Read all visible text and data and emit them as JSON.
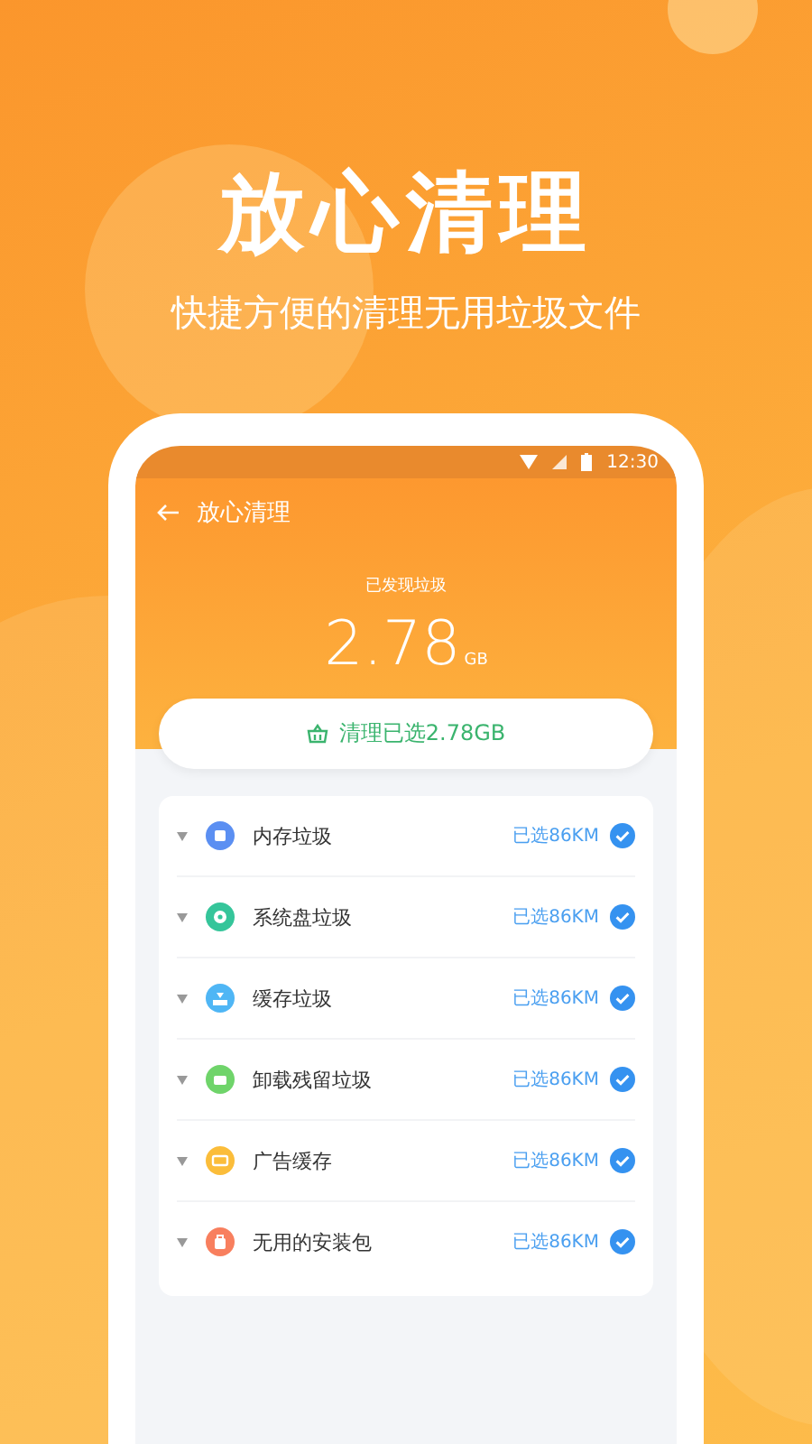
{
  "headline": "放心清理",
  "subtitle": "快捷方便的清理无用垃圾文件",
  "status_bar": {
    "time": "12:30"
  },
  "app_bar": {
    "title": "放心清理"
  },
  "summary": {
    "label": "已发现垃圾",
    "size": "2.78",
    "unit": "GB"
  },
  "clean_button": {
    "label": "清理已选2.78GB"
  },
  "items": [
    {
      "kind": "memory",
      "label": "内存垃圾",
      "selected_size": "已选86KM",
      "checked": true,
      "color": "#5b8ff2"
    },
    {
      "kind": "disk",
      "label": "系统盘垃圾",
      "selected_size": "已选86KM",
      "checked": true,
      "color": "#35c59a"
    },
    {
      "kind": "cache",
      "label": "缓存垃圾",
      "selected_size": "已选86KM",
      "checked": true,
      "color": "#4fb6f5"
    },
    {
      "kind": "uninstall",
      "label": "卸载残留垃圾",
      "selected_size": "已选86KM",
      "checked": true,
      "color": "#6fd46a"
    },
    {
      "kind": "ad",
      "label": "广告缓存",
      "selected_size": "已选86KM",
      "checked": true,
      "color": "#fbbd3a"
    },
    {
      "kind": "package",
      "label": "无用的安装包",
      "selected_size": "已选86KM",
      "checked": true,
      "color": "#f87f5e"
    }
  ]
}
